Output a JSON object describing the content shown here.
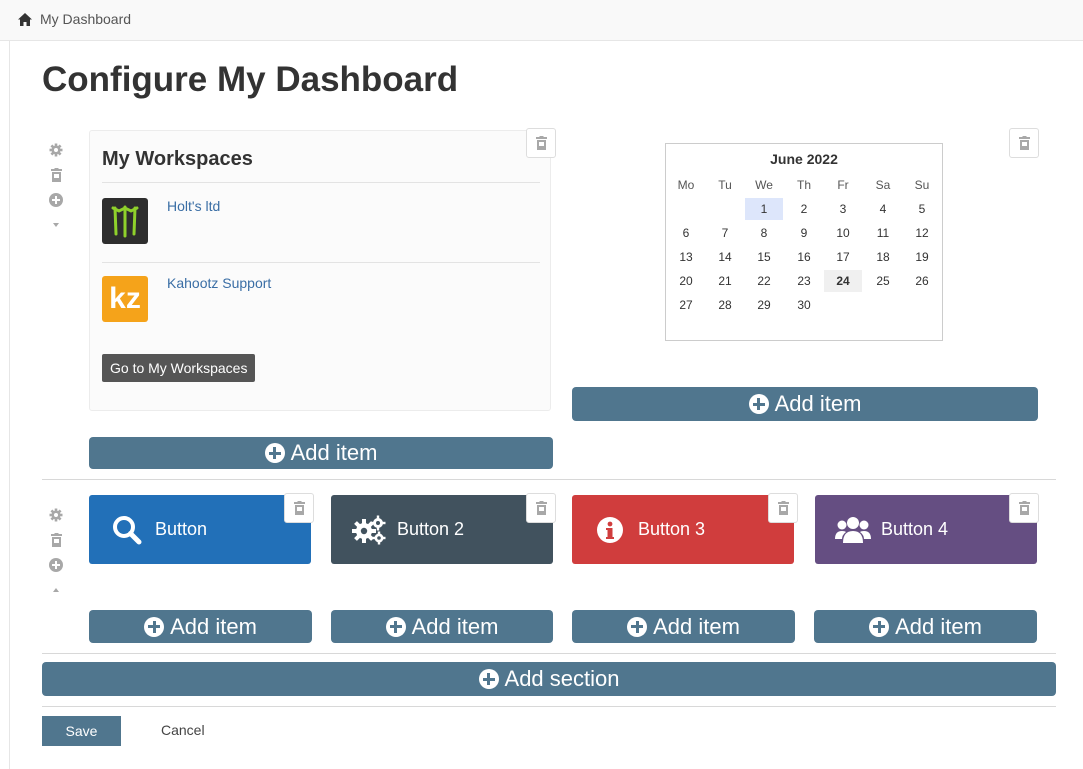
{
  "breadcrumb": {
    "home_icon": "home-icon",
    "label": "My Dashboard"
  },
  "page_title": "Configure My Dashboard",
  "section1": {
    "workspaces_widget": {
      "title": "My Workspaces",
      "items": [
        {
          "name": "Holt's ltd",
          "logo": "monster-logo"
        },
        {
          "name": "Kahootz Support",
          "logo_text": "kz",
          "logo_color": "#f5a31a"
        }
      ],
      "goto_label": "Go to My Workspaces"
    },
    "calendar": {
      "month_title": "June 2022",
      "day_headers": [
        "Mo",
        "Tu",
        "We",
        "Th",
        "Fr",
        "Sa",
        "Su"
      ],
      "weeks": [
        [
          "",
          "",
          "1",
          "2",
          "3",
          "4",
          "5"
        ],
        [
          "6",
          "7",
          "8",
          "9",
          "10",
          "11",
          "12"
        ],
        [
          "13",
          "14",
          "15",
          "16",
          "17",
          "18",
          "19"
        ],
        [
          "20",
          "21",
          "22",
          "23",
          "24",
          "25",
          "26"
        ],
        [
          "27",
          "28",
          "29",
          "30",
          "",
          "",
          ""
        ]
      ],
      "selected_day": "1",
      "today": "24"
    },
    "add_item_label": "Add item"
  },
  "section2": {
    "tiles": [
      {
        "label": "Button",
        "icon": "search-icon",
        "color": "#2270b8"
      },
      {
        "label": "Button 2",
        "icon": "gears-icon",
        "color": "#41525e"
      },
      {
        "label": "Button 3",
        "icon": "info-icon",
        "color": "#d03d3d"
      },
      {
        "label": "Button 4",
        "icon": "users-icon",
        "color": "#654e82"
      }
    ],
    "add_item_label": "Add item"
  },
  "add_section_label": "Add section",
  "footer": {
    "save_label": "Save",
    "cancel_label": "Cancel"
  },
  "colors": {
    "accent": "#50768e"
  }
}
